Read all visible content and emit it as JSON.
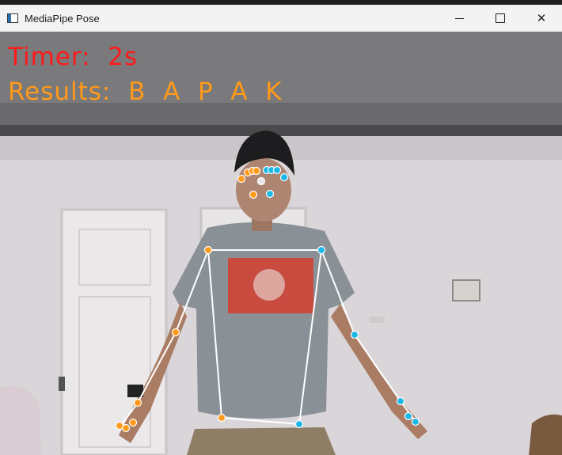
{
  "window": {
    "title": "MediaPipe Pose"
  },
  "controls": {
    "minimize": "minimize",
    "maximize": "maximize",
    "close": "✕"
  },
  "overlay": {
    "timer_label": "Timer:  2s",
    "results_label": "Results:  B  A  P  A  K"
  },
  "colors": {
    "timer": "#ff1a1a",
    "results": "#ff9a1a",
    "left_landmarks": "#ff9a1a",
    "right_landmarks": "#1ab8e6",
    "skeleton": "#ffffff"
  }
}
